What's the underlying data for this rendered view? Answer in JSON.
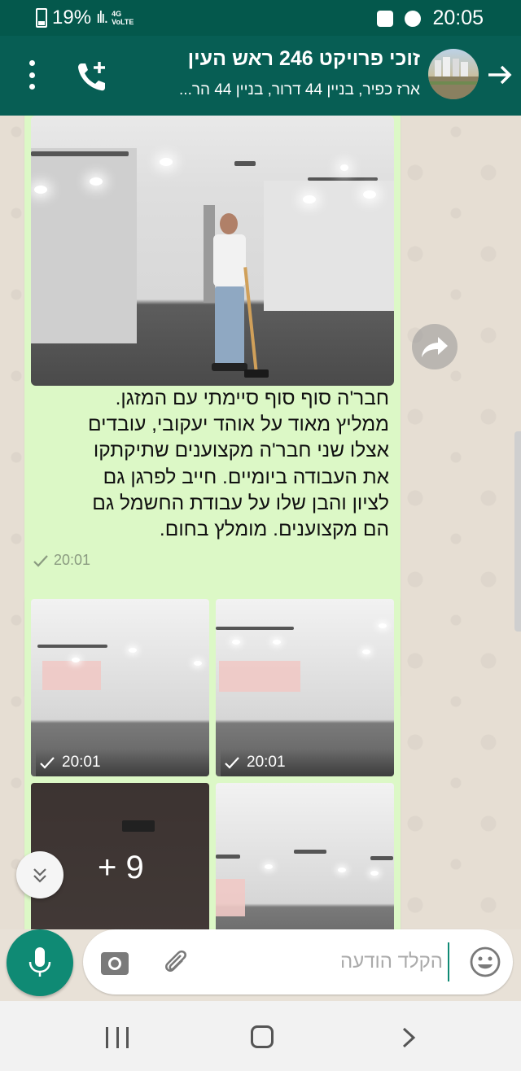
{
  "status_bar": {
    "battery": "19%",
    "network": "4G",
    "network2": "VoLTE",
    "time": "20:05"
  },
  "chat_header": {
    "title": "זוכי פרויקט 246 ראש העין",
    "subtitle": "ארז כפיר, בניין 44 דרור, בניין 44 הר..."
  },
  "messages": [
    {
      "type": "image_with_caption",
      "caption_lines": [
        "חבר'ה סוף סוף סיימתי עם המזגן.",
        "ממליץ מאוד על אוהד יעקובי, עובדים",
        "אצלו שני חבר'ה מקצוענים שתיקתקו",
        "את העבודה ביומיים. חייב לפרגן גם",
        "לציון והבן שלו על עבודת החשמל גם",
        "הם מקצוענים. מומלץ בחום."
      ],
      "time": "20:01"
    },
    {
      "type": "image_grid",
      "images": [
        {
          "time": "20:01"
        },
        {
          "time": "20:01"
        },
        {
          "time": ""
        },
        {
          "time": ""
        }
      ],
      "more_count": "+ 9"
    }
  ],
  "input": {
    "placeholder": "הקלד הודעה"
  },
  "icons": [
    "menu-icon",
    "call-add-icon",
    "back-arrow-icon",
    "forward-icon",
    "scroll-down-icon",
    "mic-icon",
    "camera-icon",
    "attach-icon",
    "emoji-icon"
  ]
}
